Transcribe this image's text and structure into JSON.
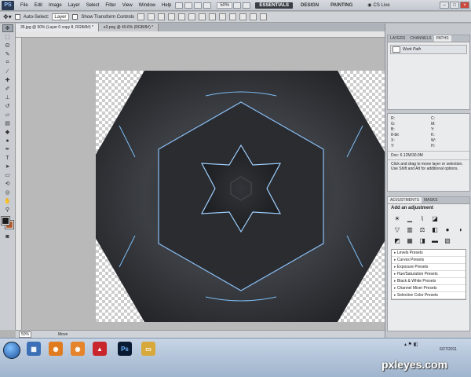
{
  "app": {
    "logo_text": "PS"
  },
  "menu": [
    "File",
    "Edit",
    "Image",
    "Layer",
    "Select",
    "Filter",
    "View",
    "Window",
    "Help"
  ],
  "zoom_level": "50%",
  "workspaces": [
    {
      "label": "ESSENTIALS",
      "active": true
    },
    {
      "label": "DESIGN",
      "active": false
    },
    {
      "label": "PAINTING",
      "active": false
    }
  ],
  "cs_live": "CS Live",
  "options": {
    "auto_select_label": "Auto-Select:",
    "auto_select_value": "Layer",
    "transform_label": "Show Transform Controls"
  },
  "tabs": [
    {
      "label": "35.jpg @ 50% (Layer 0 copy 8, RGB/8#) *",
      "active": true
    },
    {
      "label": "e3.png @ 49.6% (RGB/8#) *",
      "active": false
    }
  ],
  "status": {
    "zoom": "50%",
    "message": "Move"
  },
  "panels": {
    "paths_tabs": [
      "LAYERS",
      "CHANNELS",
      "PATHS"
    ],
    "paths_active": 2,
    "work_path": "Work Path",
    "info": {
      "labels": [
        "R:",
        "C:",
        "G:",
        "M:",
        "B:",
        "Y:",
        "8-bit",
        "K:",
        "X:",
        "W:",
        "Y:",
        "H:"
      ],
      "doc": "Doc: 6.12M/30.9M",
      "hint": "Click and drag to move layer or selection. Use Shift and Alt for additional options."
    },
    "adj_tabs": [
      "ADJUSTMENTS",
      "MASKS"
    ],
    "adj_title": "Add an adjustment",
    "presets": [
      "Levels Presets",
      "Curves Presets",
      "Exposure Presets",
      "Hue/Saturation Presets",
      "Black & White Presets",
      "Channel Mixer Presets",
      "Selective Color Presets"
    ]
  },
  "taskbar": {
    "date": "6/27/2011"
  },
  "watermark": "pxleyes.com"
}
